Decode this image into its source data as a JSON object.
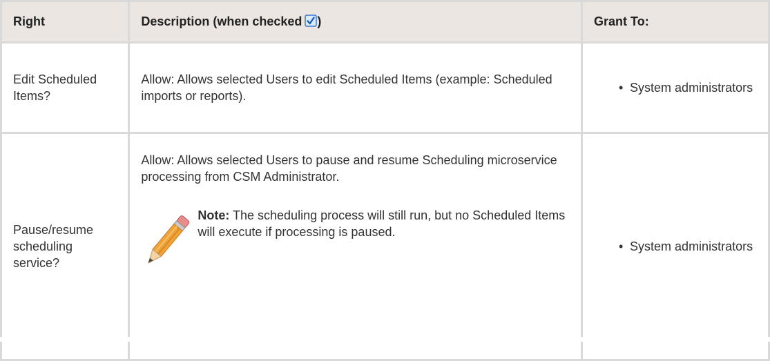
{
  "table": {
    "headers": {
      "right": "Right",
      "description": "Description (when checked",
      "description_suffix": ")",
      "grant_to": "Grant To:"
    },
    "rows": [
      {
        "right": "Edit Scheduled Items?",
        "description": "Allow: Allows selected Users to edit Scheduled Items (example: Scheduled imports or reports).",
        "grant_to": [
          "System administrators"
        ]
      },
      {
        "right": "Pause/resume scheduling service?",
        "description": "Allow: Allows selected Users to pause and resume Scheduling microservice processing from CSM Administrator.",
        "note_label": "Note:",
        "note_text": " The scheduling process will still run, but no Scheduled Items will execute if processing is paused.",
        "grant_to": [
          "System administrators"
        ]
      }
    ]
  },
  "icons": {
    "header_checkbox": "checked-checkbox-icon",
    "note": "pencil-icon"
  },
  "colors": {
    "header_background": "#ebe6e2",
    "border": "#d9d9d9",
    "checkbox_fill": "#3b7bd4",
    "pencil_body": "#f0a33a"
  }
}
